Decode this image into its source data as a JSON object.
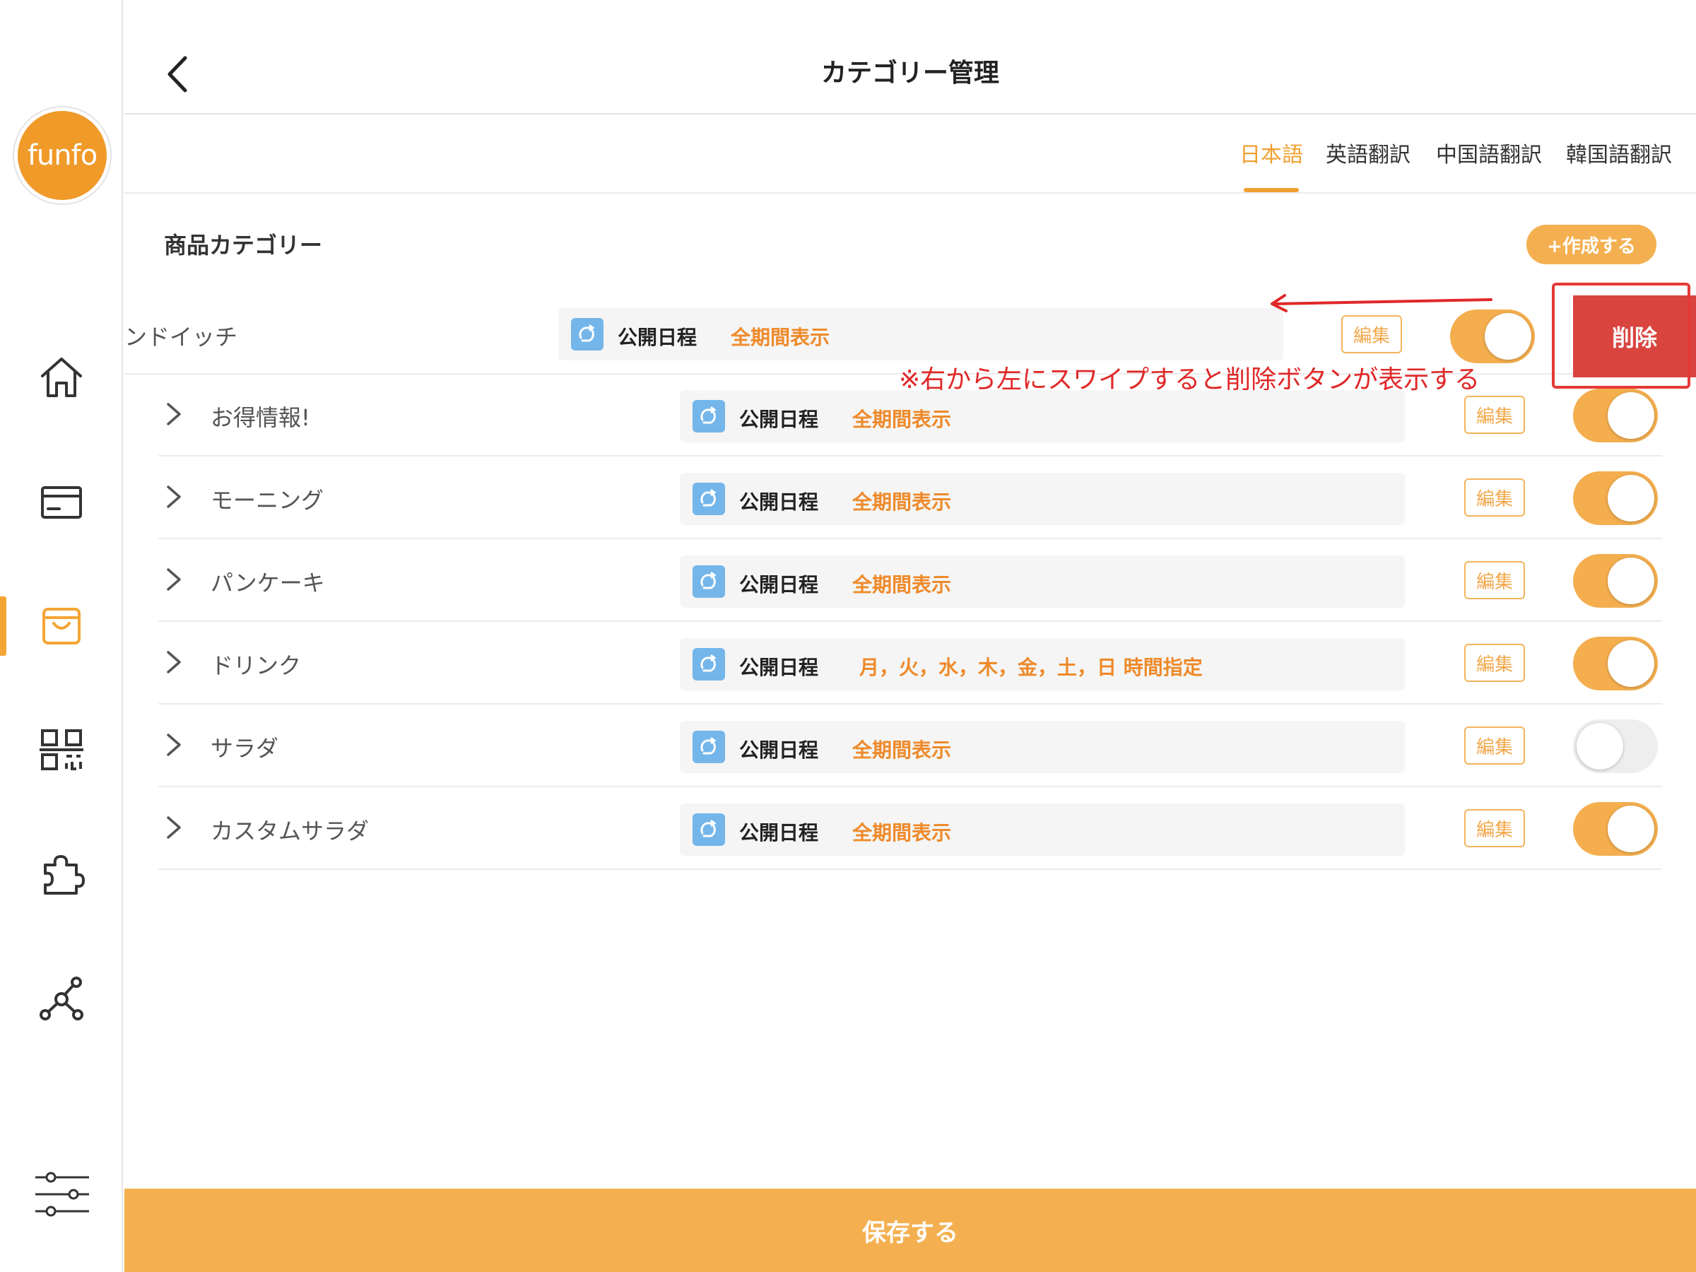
{
  "header": {
    "title": "カテゴリー管理"
  },
  "logo": {
    "text": "funfo",
    "color": "#f09a2a"
  },
  "tabs": [
    {
      "label": "日本語",
      "active": true
    },
    {
      "label": "英語翻訳",
      "active": false
    },
    {
      "label": "中国語翻訳",
      "active": false
    },
    {
      "label": "韓国語翻訳",
      "active": false
    }
  ],
  "section": {
    "title": "商品カテゴリー",
    "create_label": "+作成する"
  },
  "swiped_row": {
    "name": "ンドイッチ",
    "schedule_label": "公開日程",
    "schedule_value": "全期間表示",
    "edit_label": "編集",
    "enabled": true,
    "delete_label": "削除"
  },
  "annotation": {
    "note": "※右から左にスワイプすると削除ボタンが表示する"
  },
  "rows": [
    {
      "name": "お得情報!",
      "schedule_label": "公開日程",
      "schedule_value": "全期間表示",
      "edit_label": "編集",
      "enabled": true
    },
    {
      "name": "モーニング",
      "schedule_label": "公開日程",
      "schedule_value": "全期間表示",
      "edit_label": "編集",
      "enabled": true
    },
    {
      "name": "パンケーキ",
      "schedule_label": "公開日程",
      "schedule_value": "全期間表示",
      "edit_label": "編集",
      "enabled": true
    },
    {
      "name": "ドリンク",
      "schedule_label": "公開日程",
      "schedule_value": "月，火，水，木，金，土，日 時間指定",
      "edit_label": "編集",
      "enabled": true
    },
    {
      "name": "サラダ",
      "schedule_label": "公開日程",
      "schedule_value": "全期間表示",
      "edit_label": "編集",
      "enabled": false
    },
    {
      "name": "カスタムサラダ",
      "schedule_label": "公開日程",
      "schedule_value": "全期間表示",
      "edit_label": "編集",
      "enabled": true
    }
  ],
  "footer": {
    "save_label": "保存する"
  },
  "colors": {
    "accent": "#f4b050",
    "tab_active": "#f0a030",
    "delete": "#d9443f",
    "note": "#e02828"
  }
}
